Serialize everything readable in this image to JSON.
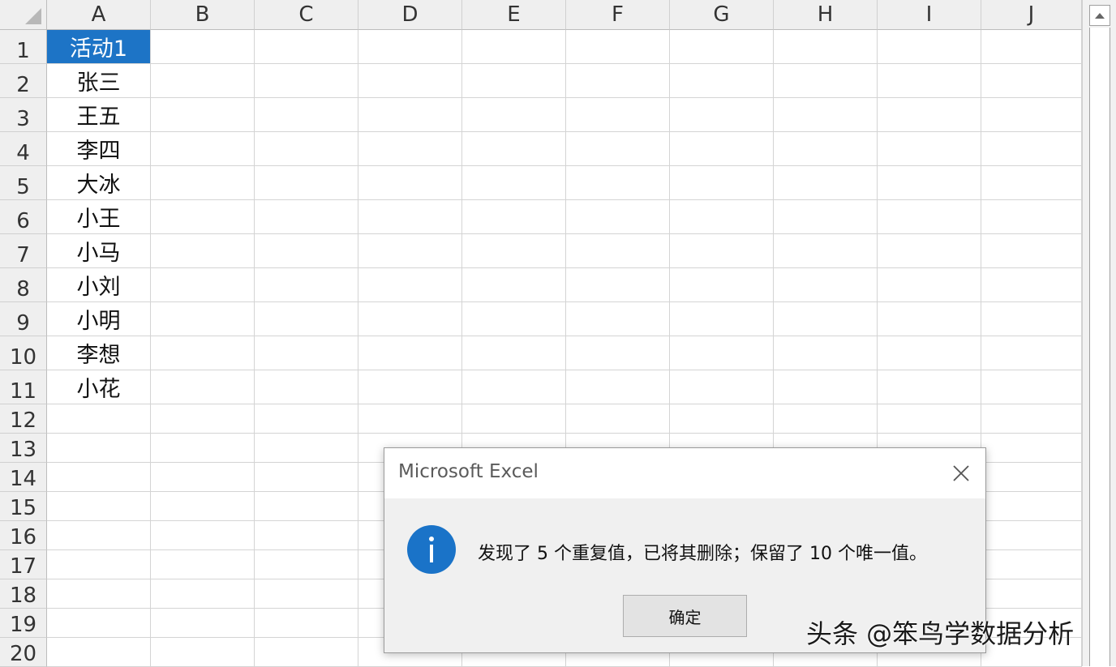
{
  "sheet": {
    "columns": [
      "A",
      "B",
      "C",
      "D",
      "E",
      "F",
      "G",
      "H",
      "I",
      "J"
    ],
    "rows": [
      "1",
      "2",
      "3",
      "4",
      "5",
      "6",
      "7",
      "8",
      "9",
      "10",
      "11",
      "12",
      "13",
      "14",
      "15",
      "16",
      "17",
      "18",
      "19",
      "20"
    ],
    "column_a_values": [
      "活动1",
      "张三",
      "王五",
      "李四",
      "大冰",
      "小王",
      "小马",
      "小刘",
      "小明",
      "李想",
      "小花"
    ],
    "selected_cell": "A1"
  },
  "dialog": {
    "title": "Microsoft Excel",
    "message": "发现了 5 个重复值，已将其删除；保留了 10 个唯一值。",
    "ok_label": "确定",
    "icon": "info-icon",
    "close_icon": "close-icon"
  },
  "watermark": "头条 @笨鸟学数据分析",
  "colors": {
    "selection": "#1d74c6",
    "info_icon": "#1a73c8",
    "header_bg": "#efefef",
    "gridline": "#d4d4d4"
  }
}
